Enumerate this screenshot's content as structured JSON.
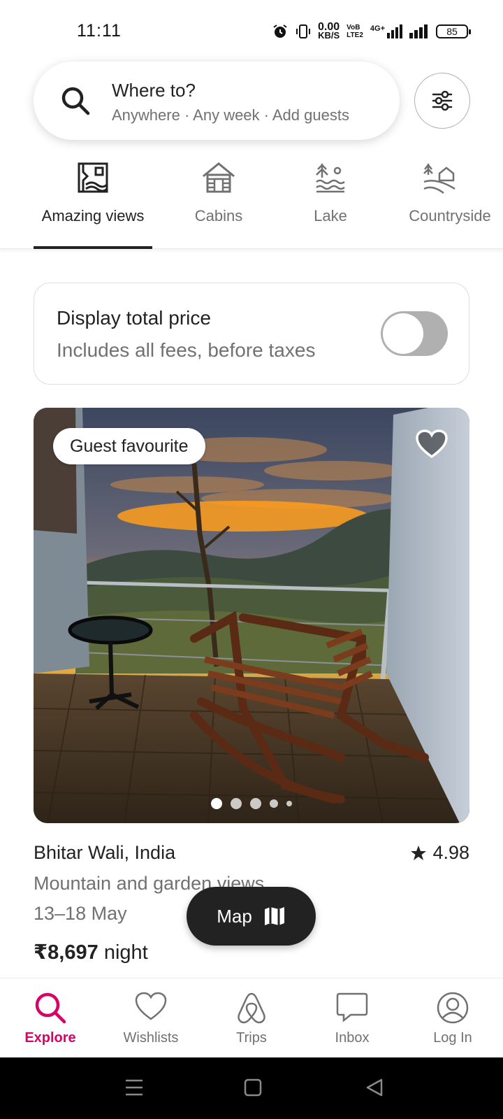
{
  "status_bar": {
    "time": "11:11",
    "net_speed_value": "0.00",
    "net_speed_unit": "KB/S",
    "volte_top": "VoB",
    "volte_bottom": "LTE2",
    "network": "4G+",
    "battery": "85"
  },
  "search": {
    "title": "Where to?",
    "subtitle": "Anywhere · Any week · Add guests"
  },
  "categories": [
    {
      "label": "Amazing views",
      "icon": "amazing-views-icon",
      "active": true
    },
    {
      "label": "Cabins",
      "icon": "cabins-icon",
      "active": false
    },
    {
      "label": "Lake",
      "icon": "lake-icon",
      "active": false
    },
    {
      "label": "Countryside",
      "icon": "countryside-icon",
      "active": false
    }
  ],
  "price_toggle": {
    "title": "Display total price",
    "subtitle": "Includes all fees, before taxes",
    "enabled": false
  },
  "listing": {
    "badge": "Guest favourite",
    "title": "Bhitar Wali, India",
    "rating": "4.98",
    "description": "Mountain and garden views",
    "dates": "13–18 May",
    "price": "₹8,697",
    "price_unit": "night",
    "photo_count_dots": 5,
    "active_photo": 1
  },
  "map_button": {
    "label": "Map"
  },
  "bottom_nav": [
    {
      "label": "Explore",
      "icon": "search-icon",
      "active": true
    },
    {
      "label": "Wishlists",
      "icon": "heart-icon",
      "active": false
    },
    {
      "label": "Trips",
      "icon": "airbnb-logo-icon",
      "active": false
    },
    {
      "label": "Inbox",
      "icon": "message-icon",
      "active": false
    },
    {
      "label": "Log In",
      "icon": "user-circle-icon",
      "active": false
    }
  ],
  "colors": {
    "accent": "#d70466",
    "text_primary": "#222222",
    "text_secondary": "#717171",
    "border": "#dddddd"
  }
}
